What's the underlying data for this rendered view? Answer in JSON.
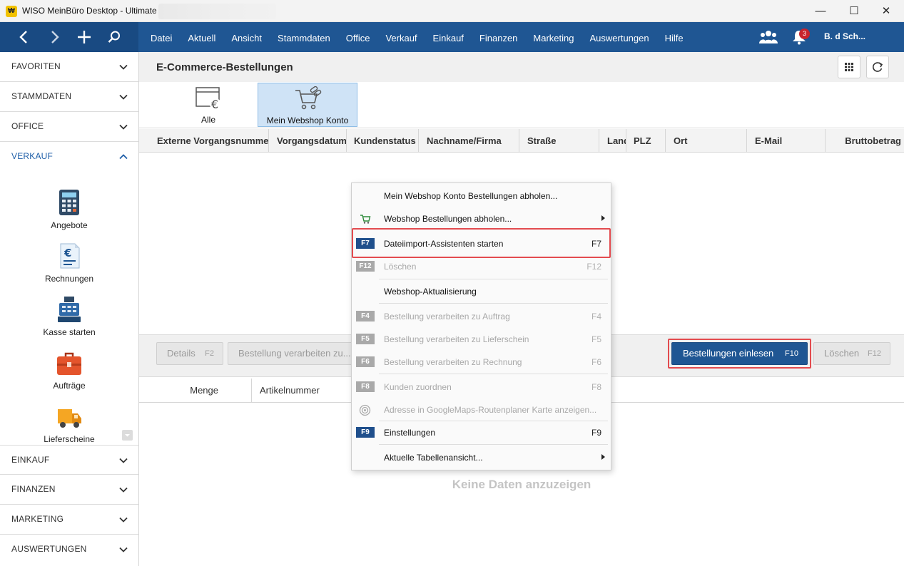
{
  "window": {
    "title": "WISO MeinBüro Desktop - Ultimate",
    "app_logo": "app-logo-icon"
  },
  "menubar": {
    "items": [
      "Datei",
      "Aktuell",
      "Ansicht",
      "Stammdaten",
      "Office",
      "Verkauf",
      "Einkauf",
      "Finanzen",
      "Marketing",
      "Auswertungen",
      "Hilfe"
    ],
    "notification_count": "3",
    "user": "B. d Sch..."
  },
  "sidebar": {
    "sections_top": [
      "FAVORITEN",
      "STAMMDATEN",
      "OFFICE"
    ],
    "active_section": "VERKAUF",
    "tiles": [
      {
        "label": "Angebote",
        "icon": "calculator-icon"
      },
      {
        "label": "Rechnungen",
        "icon": "invoice-euro-icon"
      },
      {
        "label": "Kasse starten",
        "icon": "cash-register-icon"
      },
      {
        "label": "Aufträge",
        "icon": "briefcase-icon"
      },
      {
        "label": "Lieferscheine",
        "icon": "delivery-truck-icon"
      }
    ],
    "sections_bottom": [
      "EINKAUF",
      "FINANZEN",
      "MARKETING",
      "AUSWERTUNGEN"
    ]
  },
  "page": {
    "title": "E-Commerce-Bestellungen",
    "filters": [
      {
        "label": "Alle",
        "selected": false
      },
      {
        "label": "Mein Webshop Konto",
        "selected": true
      }
    ],
    "columns": [
      "Externe Vorgangsnummer",
      "Vorgangsdatum",
      "Kundenstatus",
      "Nachname/Firma",
      "Straße",
      "Land",
      "PLZ",
      "Ort",
      "E-Mail",
      "Bruttobetrag"
    ],
    "actions": {
      "details": {
        "label": "Details",
        "key": "F2"
      },
      "verarbeiten": {
        "label": "Bestellung verarbeiten zu...",
        "key": ""
      },
      "einlesen": {
        "label": "Bestellungen einlesen",
        "key": "F10"
      },
      "loeschen": {
        "label": "Löschen",
        "key": "F12"
      }
    },
    "detail_columns": [
      "Menge",
      "Artikelnummer"
    ],
    "empty_text": "Keine Daten anzuzeigen"
  },
  "context_menu": {
    "items": [
      {
        "label": "Mein Webshop Konto Bestellungen abholen...",
        "fkey": "",
        "key": "",
        "disabled": false
      },
      {
        "label": "Webshop Bestellungen abholen...",
        "fkey": "",
        "key": "",
        "disabled": false,
        "submenu": true
      },
      {
        "label": "Dateiimport-Assistenten starten",
        "fkey": "F7",
        "key": "F7",
        "disabled": false,
        "highlighted": true
      },
      {
        "label": "Löschen",
        "fkey": "F12",
        "key": "F12",
        "disabled": true
      },
      {
        "label": "Webshop-Aktualisierung",
        "fkey": "",
        "key": "",
        "disabled": false
      },
      {
        "label": "Bestellung verarbeiten zu Auftrag",
        "fkey": "F4",
        "key": "F4",
        "disabled": true
      },
      {
        "label": "Bestellung verarbeiten zu Lieferschein",
        "fkey": "F5",
        "key": "F5",
        "disabled": true
      },
      {
        "label": "Bestellung verarbeiten zu Rechnung",
        "fkey": "F6",
        "key": "F6",
        "disabled": true
      },
      {
        "label": "Kunden zuordnen",
        "fkey": "F8",
        "key": "F8",
        "disabled": true
      },
      {
        "label": "Adresse in GoogleMaps-Routenplaner Karte anzeigen...",
        "fkey": "",
        "key": "",
        "disabled": true
      },
      {
        "label": "Einstellungen",
        "fkey": "F9",
        "key": "F9",
        "disabled": false
      },
      {
        "label": "Aktuelle Tabellenansicht...",
        "fkey": "",
        "key": "",
        "disabled": false,
        "submenu": true
      }
    ]
  },
  "colors": {
    "brand_blue": "#1f5693",
    "highlight_red": "#e34b4f",
    "selected_filter": "#cfe3f6"
  }
}
